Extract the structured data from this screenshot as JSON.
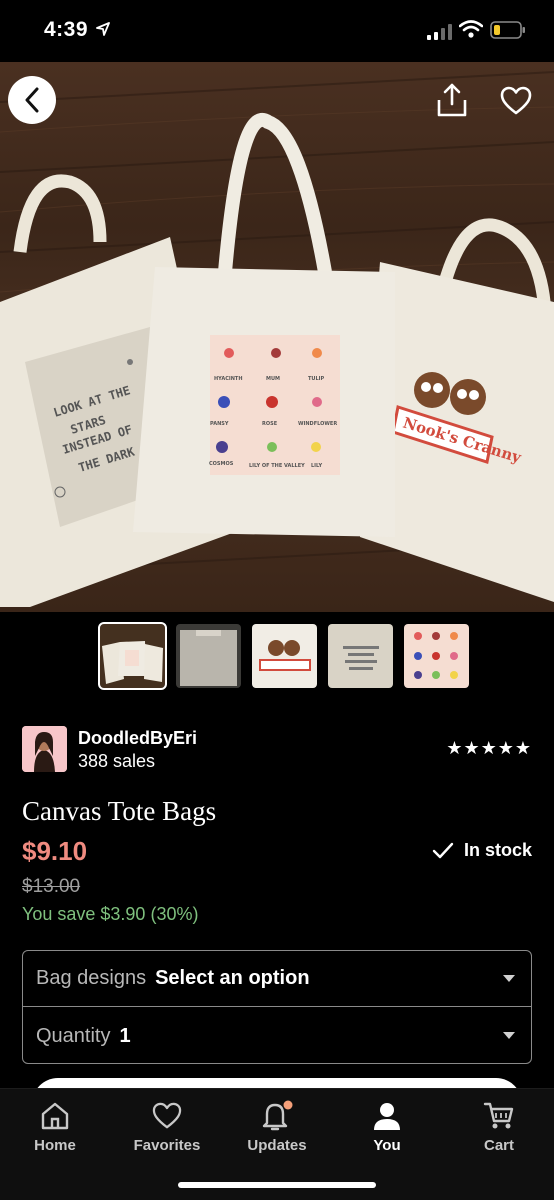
{
  "status_bar": {
    "time": "4:39"
  },
  "listing": {
    "seller_name": "DoodledByEri",
    "seller_sales": "388 sales",
    "rating_stars": "★★★★★",
    "title": "Canvas Tote Bags",
    "price": "$9.10",
    "original_price": "$13.00",
    "savings": "You save $3.90 (30%)",
    "stock": "In stock"
  },
  "hero_image": {
    "tote_left_text": "LOOK AT THE STARS INSTEAD OF THE DARK",
    "tote_right_text": "Nook's Cranny",
    "flower_labels": [
      "HYACINTH",
      "MUM",
      "TULIP",
      "PANSY",
      "ROSE",
      "WINDFLOWER",
      "COSMOS",
      "LILY OF THE VALLEY",
      "LILY"
    ]
  },
  "options": {
    "bag_designs_label": "Bag designs",
    "bag_designs_value": "Select an option",
    "quantity_label": "Quantity",
    "quantity_value": "1"
  },
  "tabs": [
    {
      "label": "Home",
      "icon": "home-icon"
    },
    {
      "label": "Favorites",
      "icon": "heart-icon"
    },
    {
      "label": "Updates",
      "icon": "bell-icon"
    },
    {
      "label": "You",
      "icon": "person-icon"
    },
    {
      "label": "Cart",
      "icon": "cart-icon"
    }
  ],
  "colors": {
    "price": "#f08b80",
    "savings": "#7fc07e",
    "notification_dot": "#f5a07a"
  }
}
